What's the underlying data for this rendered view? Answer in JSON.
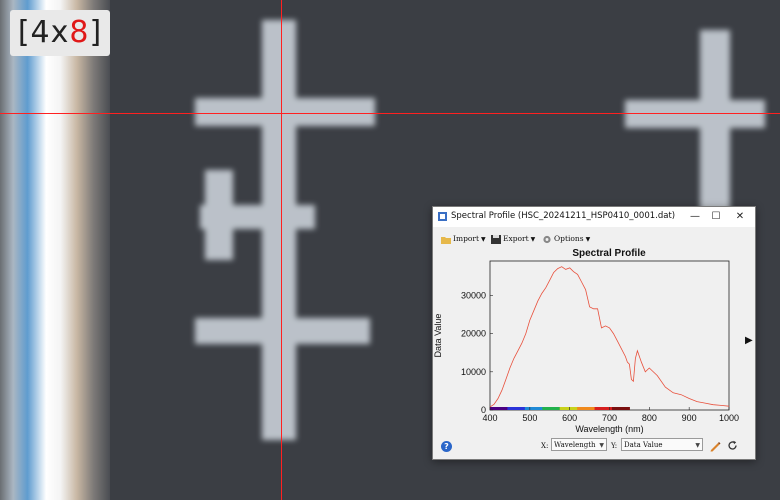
{
  "viewer": {
    "zoom_badge": {
      "prefix": "[4x",
      "accent": "8",
      "suffix": "]",
      "accent_color": "#e01818"
    },
    "crosshair_color": "#ff2020"
  },
  "window": {
    "title": "Spectral Profile (HSC_20241211_HSP0410_0001.dat)",
    "controls": {
      "minimize": "—",
      "maximize": "☐",
      "close": "✕"
    },
    "toolbar": {
      "import_label": "Import",
      "export_label": "Export",
      "options_label": "Options"
    },
    "bottom": {
      "x_label": "X:",
      "x_value": "Wavelength",
      "y_label": "Y:",
      "y_value": "Data Value",
      "help_icon": "?"
    }
  },
  "chart_data": {
    "type": "line",
    "title": "Spectral Profile",
    "xlabel": "Wavelength (nm)",
    "ylabel": "Data Value",
    "xlim": [
      400,
      1000
    ],
    "ylim": [
      0,
      39000
    ],
    "x_ticks": [
      400,
      500,
      600,
      700,
      800,
      900,
      1000
    ],
    "y_ticks": [
      0,
      10000,
      20000,
      30000
    ],
    "line_color": "#e8503c",
    "series": [
      {
        "x": [
          400,
          410,
          420,
          430,
          440,
          450,
          460,
          470,
          480,
          490,
          500,
          510,
          520,
          530,
          540,
          550,
          560,
          570,
          580,
          590,
          600,
          610,
          620,
          630,
          640,
          650,
          660,
          670,
          680,
          690,
          700,
          710,
          720,
          730,
          740,
          745,
          750,
          755,
          760,
          765,
          770,
          780,
          790,
          800,
          820,
          840,
          860,
          880,
          900,
          920,
          940,
          960,
          980,
          1000
        ],
        "values": [
          800,
          1500,
          3000,
          5200,
          8000,
          11000,
          13500,
          15500,
          17500,
          20000,
          23500,
          26000,
          28500,
          30500,
          32000,
          34000,
          36000,
          37000,
          37500,
          36800,
          37200,
          36200,
          35500,
          33500,
          31500,
          27000,
          26500,
          26500,
          21500,
          22000,
          21500,
          20000,
          18000,
          16000,
          14000,
          12500,
          12000,
          8000,
          7500,
          13500,
          15500,
          12500,
          10000,
          11000,
          9000,
          6000,
          4500,
          4000,
          3000,
          2200,
          1800,
          1400,
          1200,
          1000
        ]
      }
    ],
    "grid": false
  }
}
